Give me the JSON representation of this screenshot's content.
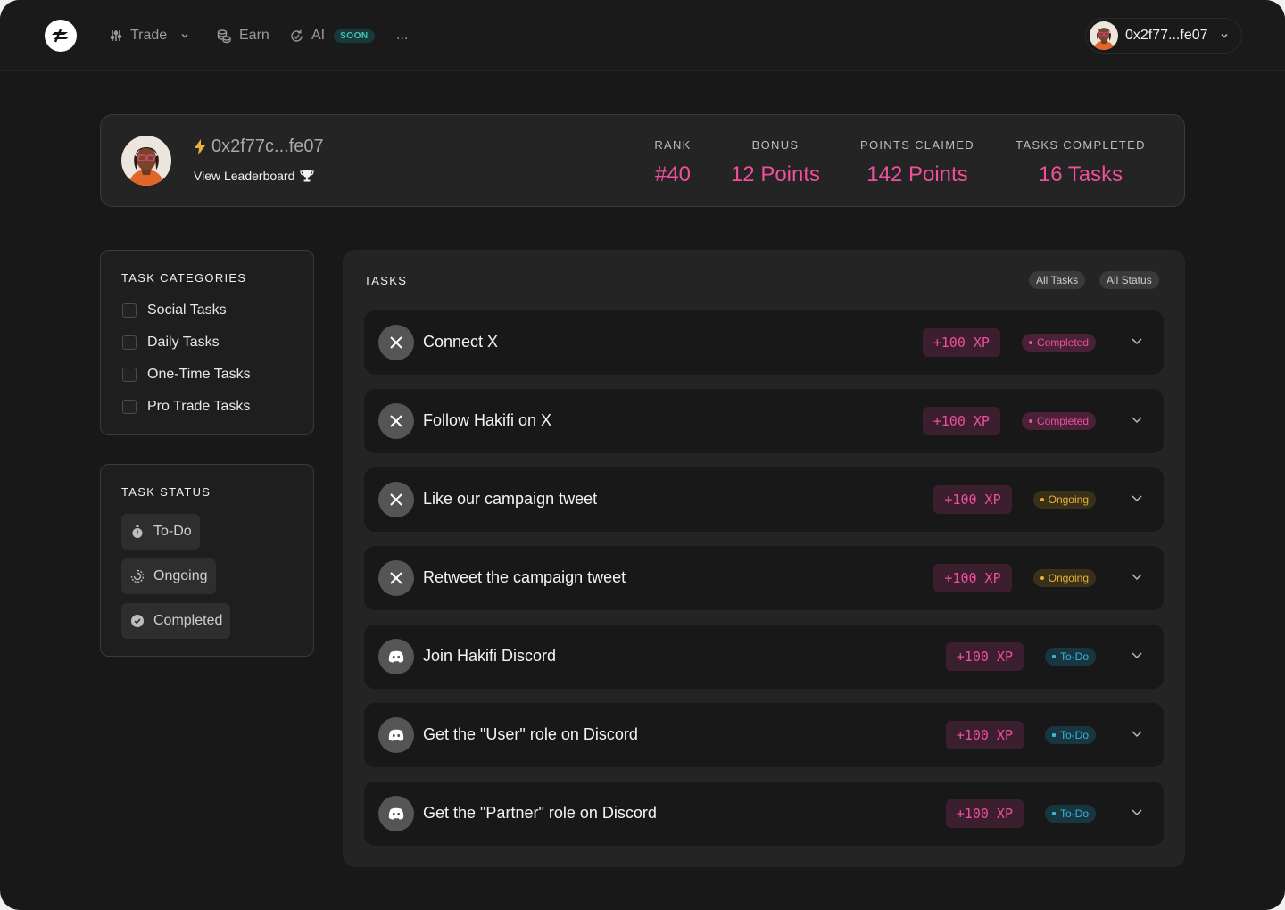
{
  "nav": {
    "items": [
      {
        "label": "Trade",
        "icon": "sliders-icon",
        "has_dropdown": true
      },
      {
        "label": "Earn",
        "icon": "coins-icon"
      },
      {
        "label": "AI",
        "icon": "refresh-ai-icon",
        "badge": "SOON"
      },
      {
        "label": "..."
      }
    ],
    "wallet": "0x2f77...fe07"
  },
  "profile": {
    "address": "0x2f77c...fe07",
    "leaderboard_link": "View Leaderboard",
    "stats": [
      {
        "label": "RANK",
        "value": "#40"
      },
      {
        "label": "BONUS",
        "value": "12 Points"
      },
      {
        "label": "POINTS CLAIMED",
        "value": "142 Points"
      },
      {
        "label": "TASKS COMPLETED",
        "value": "16 Tasks"
      }
    ]
  },
  "categories": {
    "title": "TASK CATEGORIES",
    "items": [
      "Social Tasks",
      "Daily Tasks",
      "One-Time Tasks",
      "Pro Trade Tasks"
    ]
  },
  "status_filter": {
    "title": "TASK STATUS",
    "items": [
      {
        "label": "To-Do",
        "icon": "stopwatch-icon"
      },
      {
        "label": "Ongoing",
        "icon": "progress-icon"
      },
      {
        "label": "Completed",
        "icon": "check-circle-icon"
      }
    ]
  },
  "tasks": {
    "title": "TASKS",
    "filters": [
      "All Tasks",
      "All Status"
    ],
    "items": [
      {
        "title": "Connect X",
        "icon": "x-logo-icon",
        "xp": "+100 XP",
        "status": "Completed"
      },
      {
        "title": "Follow Hakifi on X",
        "icon": "x-logo-icon",
        "xp": "+100 XP",
        "status": "Completed"
      },
      {
        "title": "Like our campaign tweet",
        "icon": "x-logo-icon",
        "xp": "+100 XP",
        "status": "Ongoing"
      },
      {
        "title": "Retweet the campaign tweet",
        "icon": "x-logo-icon",
        "xp": "+100 XP",
        "status": "Ongoing"
      },
      {
        "title": "Join Hakifi Discord",
        "icon": "discord-icon",
        "xp": "+100 XP",
        "status": "To-Do"
      },
      {
        "title": "Get the \"User\" role on Discord",
        "icon": "discord-icon",
        "xp": "+100 XP",
        "status": "To-Do"
      },
      {
        "title": "Get the \"Partner\" role on Discord",
        "icon": "discord-icon",
        "xp": "+100 XP",
        "status": "To-Do"
      }
    ]
  },
  "colors": {
    "accent": "#ef4f9c",
    "ongoing": "#e8b23a",
    "todo": "#38b2d8",
    "soon": "#49c2b6"
  }
}
